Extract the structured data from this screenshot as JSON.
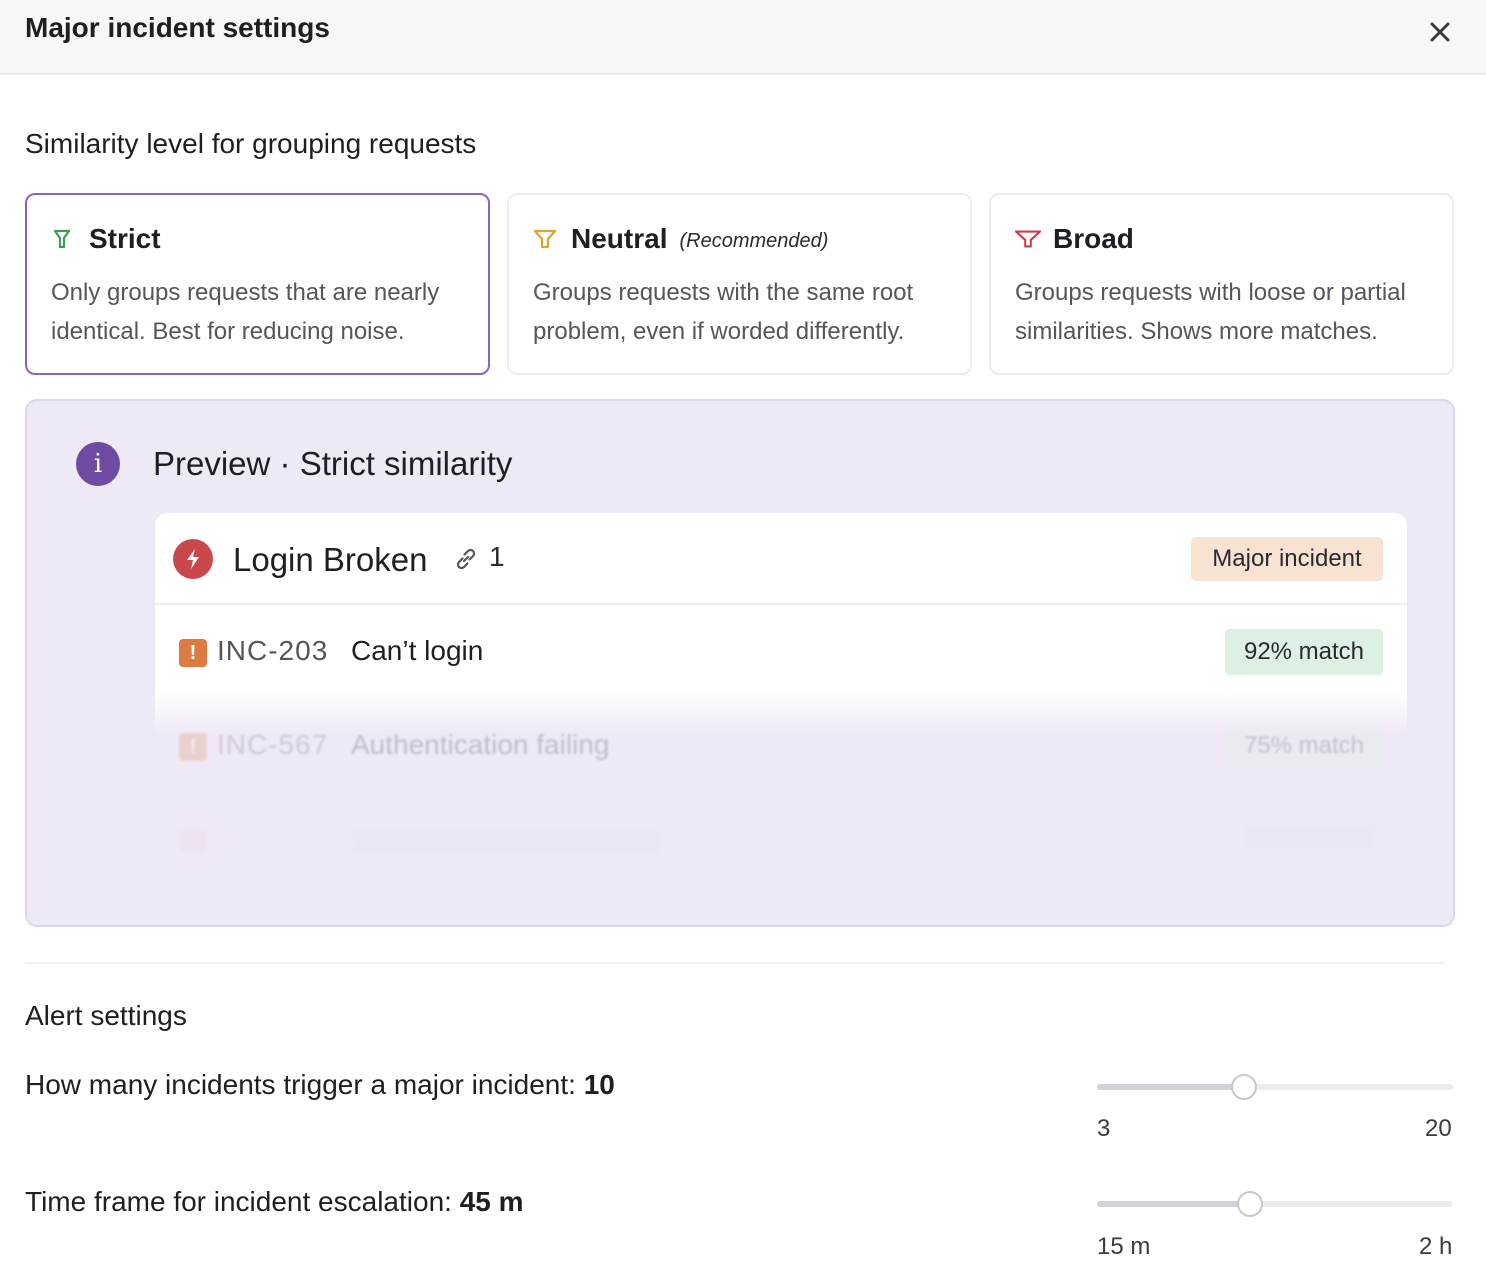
{
  "header": {
    "title": "Major incident settings"
  },
  "similarity": {
    "title": "Similarity level for grouping requests",
    "options": [
      {
        "name": "Strict",
        "desc": "Only groups requests that are nearly identical. Best for reducing noise.",
        "icon": "funnel-narrow-icon",
        "color": "#3e9a5a",
        "selected": true
      },
      {
        "name": "Neutral",
        "note": "(Recommended)",
        "desc": "Groups requests with the same root problem, even if worded differently.",
        "icon": "funnel-medium-icon",
        "color": "#d9a628",
        "selected": false
      },
      {
        "name": "Broad",
        "desc": "Groups requests with loose or partial similarities. Shows more matches.",
        "icon": "funnel-wide-icon",
        "color": "#d23c48",
        "selected": false
      }
    ]
  },
  "preview": {
    "title": "Preview · Strict similarity",
    "group": {
      "title": "Login Broken",
      "link_count": "1",
      "badge": "Major incident"
    },
    "incidents": [
      {
        "id": "INC-203",
        "title": "Can’t login",
        "match": "92% match"
      },
      {
        "id": "INC-567",
        "title": "Authentication failing",
        "match": "75% match"
      }
    ]
  },
  "alerts": {
    "title": "Alert settings",
    "trigger": {
      "label": "How many incidents trigger a major incident:",
      "value": "10",
      "min_label": "3",
      "max_label": "20",
      "min": 3,
      "max": 20,
      "current": 10
    },
    "timeframe": {
      "label": "Time frame for incident escalation:",
      "value": "45 m",
      "min_label": "15 m",
      "max_label": "2 h",
      "fraction": 0.43
    }
  }
}
